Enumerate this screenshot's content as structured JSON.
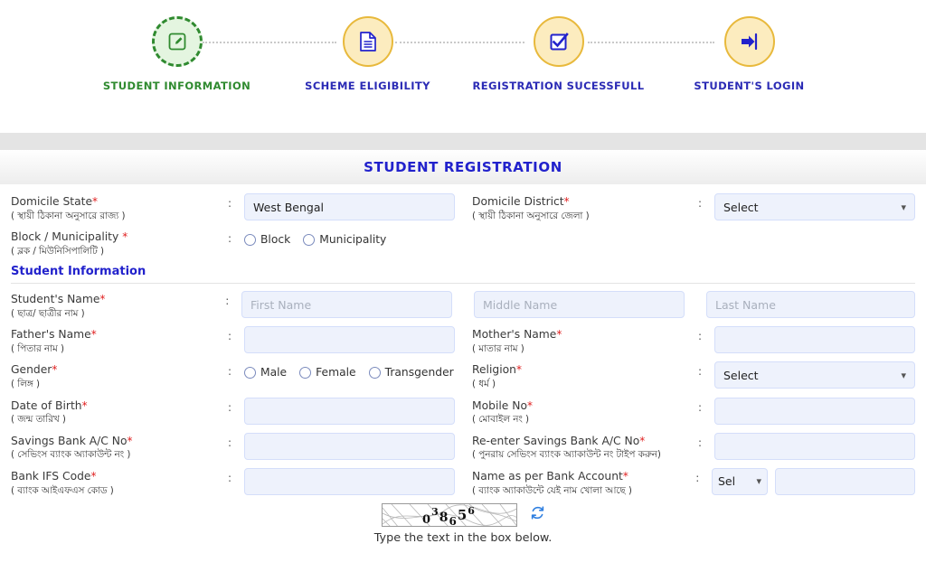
{
  "stepper": {
    "steps": [
      {
        "label": "STUDENT INFORMATION",
        "icon": "edit-document-icon",
        "state": "done"
      },
      {
        "label": "SCHEME ELIGIBILITY",
        "icon": "document-icon",
        "state": "pending"
      },
      {
        "label": "REGISTRATION SUCESSFULL",
        "icon": "checkbox-checked-icon",
        "state": "pending"
      },
      {
        "label": "STUDENT'S LOGIN",
        "icon": "login-arrow-icon",
        "state": "pending"
      }
    ]
  },
  "page": {
    "title": "STUDENT REGISTRATION",
    "colon": ":"
  },
  "domicile": {
    "state": {
      "label_en": "Domicile State",
      "required": "*",
      "label_bn": "( স্থায়ী ঠিকানা অনুসারে রাজ্য )",
      "value": "West Bengal"
    },
    "district": {
      "label_en": "Domicile District",
      "required": "*",
      "label_bn": "( স্থায়ী ঠিকানা অনুসারে জেলা )",
      "selected": "Select"
    },
    "block_municipality": {
      "label_en": "Block / Municipality ",
      "required": "*",
      "label_bn": "( ব্লক / মিউনিসিপালিটি )",
      "options": [
        "Block",
        "Municipality"
      ]
    }
  },
  "student_information": {
    "heading": "Student Information",
    "student_name": {
      "label_en": "Student's Name",
      "required": "*",
      "label_bn": "( ছাত্র/ ছাত্রীর নাম )",
      "first_placeholder": "First Name",
      "middle_placeholder": "Middle Name",
      "last_placeholder": "Last Name",
      "first_value": "",
      "middle_value": "",
      "last_value": ""
    },
    "fathers_name": {
      "label_en": "Father's Name",
      "required": "*",
      "label_bn": "( পিতার নাম )",
      "value": ""
    },
    "mothers_name": {
      "label_en": "Mother's Name",
      "required": "*",
      "label_bn": "( মাতার নাম )",
      "value": ""
    },
    "gender": {
      "label_en": "Gender",
      "required": "*",
      "label_bn": "( লিঙ্গ )",
      "options": [
        "Male",
        "Female",
        "Transgender"
      ]
    },
    "religion": {
      "label_en": "Religion",
      "required": "*",
      "label_bn": "( ধর্ম )",
      "selected": "Select"
    },
    "date_of_birth": {
      "label_en": "Date of Birth",
      "required": "*",
      "label_bn": "( জন্ম তারিখ )",
      "value": ""
    },
    "mobile_no": {
      "label_en": "Mobile No",
      "required": "*",
      "label_bn": "( মোবাইল নং )",
      "value": ""
    },
    "savings_bank_ac": {
      "label_en": "Savings Bank A/C No",
      "required": "*",
      "label_bn": "( সেভিংস ব্যাংক অ্যাকাউন্ট নং )",
      "value": ""
    },
    "reenter_savings_bank_ac": {
      "label_en": "Re-enter Savings Bank A/C No",
      "required": "*",
      "label_bn": "( পুনরায় সেভিংস ব্যাংক অ্যাকাউন্ট নং টাইপ করুন)",
      "value": ""
    },
    "bank_ifs_code": {
      "label_en": "Bank IFS Code",
      "required": "*",
      "label_bn": "( ব্যাংক আইএফএস কোড )",
      "value": ""
    },
    "name_as_per_bank": {
      "label_en": "Name as per Bank Account",
      "required": "*",
      "label_bn": "( ব্যাংক অ্যাকাউন্টে যেই নাম খোলা আছে )",
      "title_selected": "Sel",
      "value": ""
    }
  },
  "captcha": {
    "code": "038656",
    "hint": "Type the text in the box below.",
    "refresh_icon": "refresh-icon"
  },
  "colors": {
    "accent_blue": "#2222cc",
    "done_green": "#2f8a2f",
    "pending_amber": "#e8b93c",
    "pending_fill": "#fcecbf",
    "input_bg": "#eef2fc",
    "required_red": "#e02020"
  }
}
